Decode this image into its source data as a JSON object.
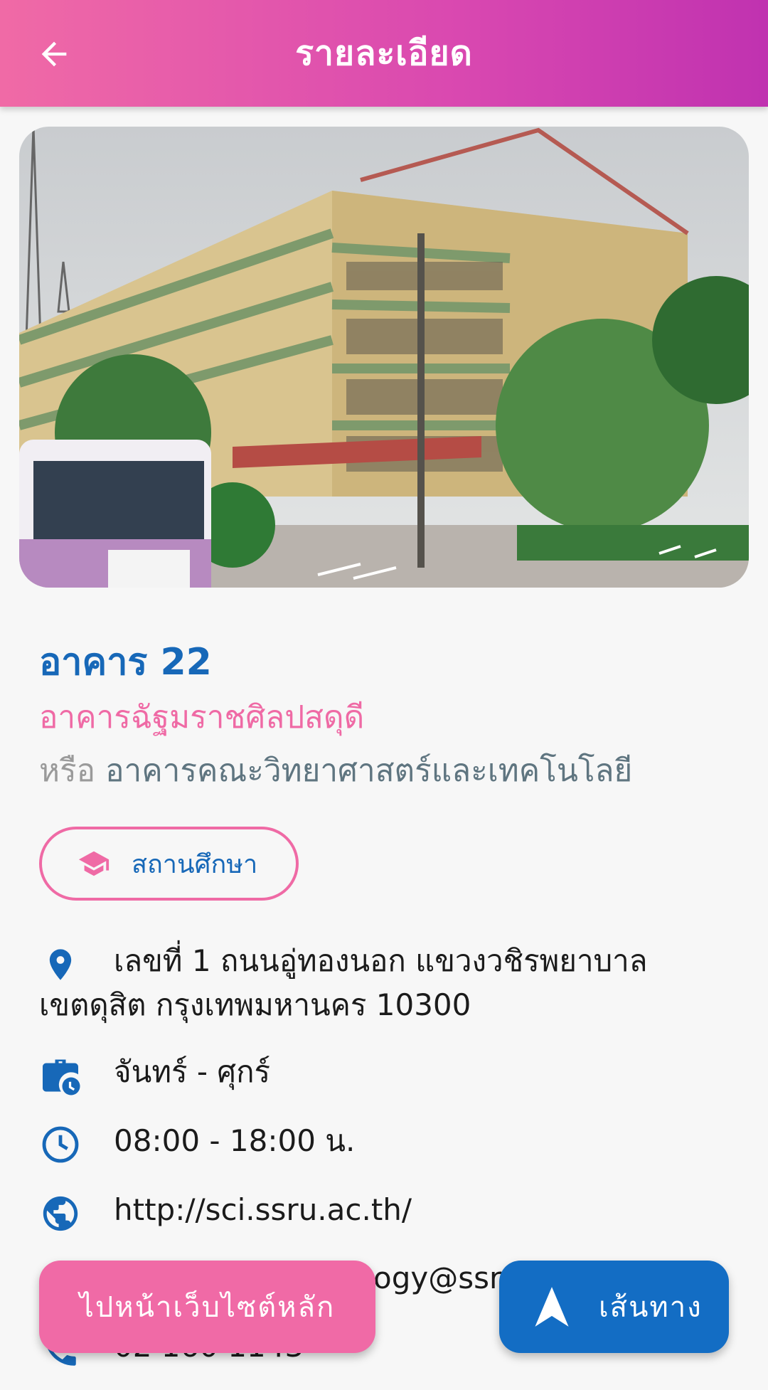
{
  "header": {
    "title": "รายละเอียด",
    "back_icon": "arrow-left-icon"
  },
  "building": {
    "name": "อาคาร 22",
    "official_name": "อาคารฉัฐมราชศิลปสดุดี",
    "alt_prefix": "หรือ",
    "alt_name": "อาคารคณะวิทยาศาสตร์และเทคโนโลยี",
    "category": {
      "label": "สถานศึกษา",
      "icon": "graduation-cap-icon"
    }
  },
  "details": {
    "address": {
      "icon": "location-pin-icon",
      "line1": "เลขที่ 1 ถนนอู่ทองนอก แขวงวชิรพยาบาล",
      "line2": "เขตดุสิต กรุงเทพมหานคร 10300"
    },
    "days": {
      "icon": "business-hours-icon",
      "text": "จันทร์ - ศุกร์"
    },
    "hours": {
      "icon": "clock-icon",
      "text": "08:00 - 18:00 น."
    },
    "website": {
      "icon": "globe-icon",
      "text": "http://sci.ssru.ac.th/"
    },
    "email": {
      "icon": "email-icon",
      "text_visible": "ogy@ssr"
    },
    "phone": {
      "icon": "phone-icon",
      "text_visible": "02 160 1143"
    }
  },
  "actions": {
    "website_button": "ไปหน้าเว็บไซต์หลัก",
    "route_button": "เส้นทาง",
    "route_icon": "navigation-arrow-icon"
  },
  "colors": {
    "header_start": "#f06aa6",
    "header_end": "#c032b0",
    "primary_blue": "#1768b8",
    "accent_pink": "#ef6aa5"
  }
}
